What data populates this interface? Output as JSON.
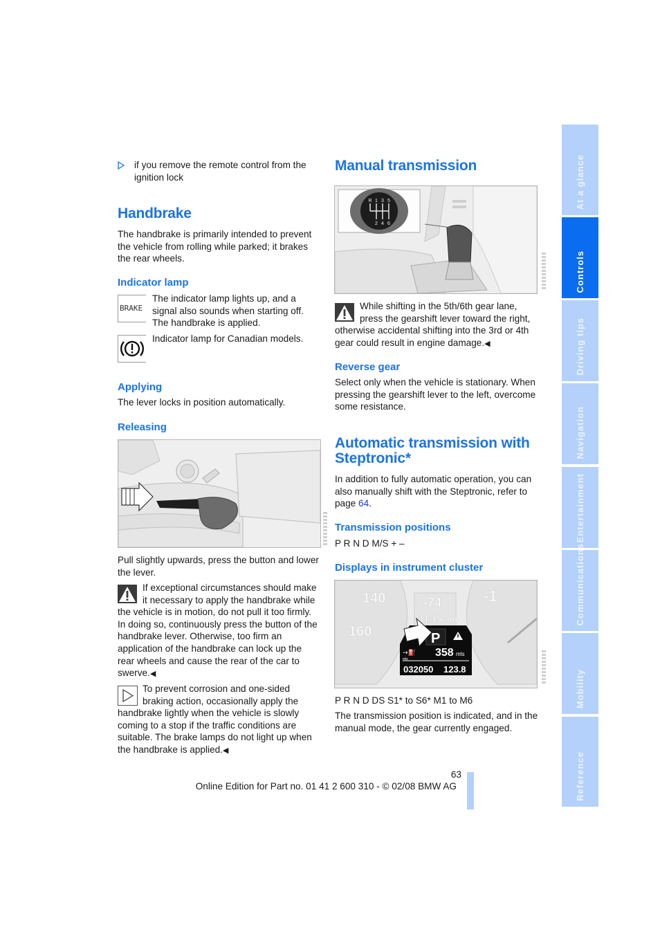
{
  "left_column": {
    "bullet_item": "if you remove the remote control from the ignition lock",
    "handbrake": {
      "title": "Handbrake",
      "intro": "The handbrake is primarily intended to prevent the vehicle from rolling while parked; it brakes the rear wheels.",
      "indicator_lamp": {
        "title": "Indicator lamp",
        "brake_icon_text": "BRAKE",
        "lamp_text": "The indicator lamp lights up, and a signal also sounds when starting off. The handbrake is applied.",
        "canadian_text": "Indicator lamp for Canadian models."
      },
      "applying": {
        "title": "Applying",
        "text": "The lever locks in position automatically."
      },
      "releasing": {
        "title": "Releasing",
        "text": "Pull slightly upwards, press the button and lower the lever.",
        "warning": "If exceptional circumstances should make it necessary to apply the handbrake while the vehicle is in motion, do not pull it too firmly. In doing so, continuously press the button of the handbrake lever. Otherwise, too firm an application of the handbrake can lock up the rear wheels and cause the rear of the car to swerve.",
        "note": "To prevent corrosion and one-sided braking action, occasionally apply the handbrake lightly when the vehicle is slowly coming to a stop if the traffic conditions are suitable. The brake lamps do not light up when the handbrake is applied."
      }
    }
  },
  "right_column": {
    "manual": {
      "title": "Manual transmission",
      "shift_pattern_top": [
        "R",
        "1",
        "3",
        "5"
      ],
      "shift_pattern_bottom": [
        "2",
        "4",
        "6"
      ],
      "warning": "While shifting in the 5th/6th gear lane, press the gearshift lever toward the right, otherwise accidental shifting into the 3rd or 4th gear could result in engine damage.",
      "reverse": {
        "title": "Reverse gear",
        "text": "Select only when the vehicle is stationary. When pressing the gearshift lever to the left, overcome some resistance."
      }
    },
    "automatic": {
      "title": "Automatic transmission with Steptronic*",
      "intro_before": "In addition to fully automatic operation, you can also manually shift with the Steptronic, refer to page ",
      "intro_link": "64",
      "intro_after": ".",
      "positions": {
        "title": "Transmission positions",
        "text": "P R N D M/S + –"
      },
      "displays": {
        "title": "Displays in instrument cluster",
        "cluster": {
          "speed_marks": [
            "140",
            "160"
          ],
          "temp": "-74",
          "time": "11:15 am",
          "gear": "P",
          "range": "358",
          "range_unit": "mls",
          "odo_unit": "mls",
          "odometer": "032050",
          "trip": "123.8",
          "right_gauge": "-1"
        },
        "positions_line": "P R N D DS S1* to S6* M1 to M6",
        "text": "The transmission position is indicated, and in the manual mode, the gear currently engaged."
      }
    }
  },
  "footer": {
    "page_number": "63",
    "edition": "Online Edition for Part no. 01 41 2 600 310 - © 02/08 BMW AG"
  },
  "sidebar": {
    "tabs": [
      {
        "label": "At a glance",
        "active": false
      },
      {
        "label": "Controls",
        "active": true
      },
      {
        "label": "Driving tips",
        "active": false
      },
      {
        "label": "Navigation",
        "active": false
      },
      {
        "label": "Entertainment",
        "active": false
      },
      {
        "label": "Communications",
        "active": false
      },
      {
        "label": "Mobility",
        "active": false
      },
      {
        "label": "Reference",
        "active": false
      }
    ]
  },
  "colors": {
    "heading": "#1a73e8",
    "tab_active": "#0a6df0",
    "tab_inactive": "#b3d1fb",
    "link": "#1a3be8"
  },
  "end_mark": "◀"
}
